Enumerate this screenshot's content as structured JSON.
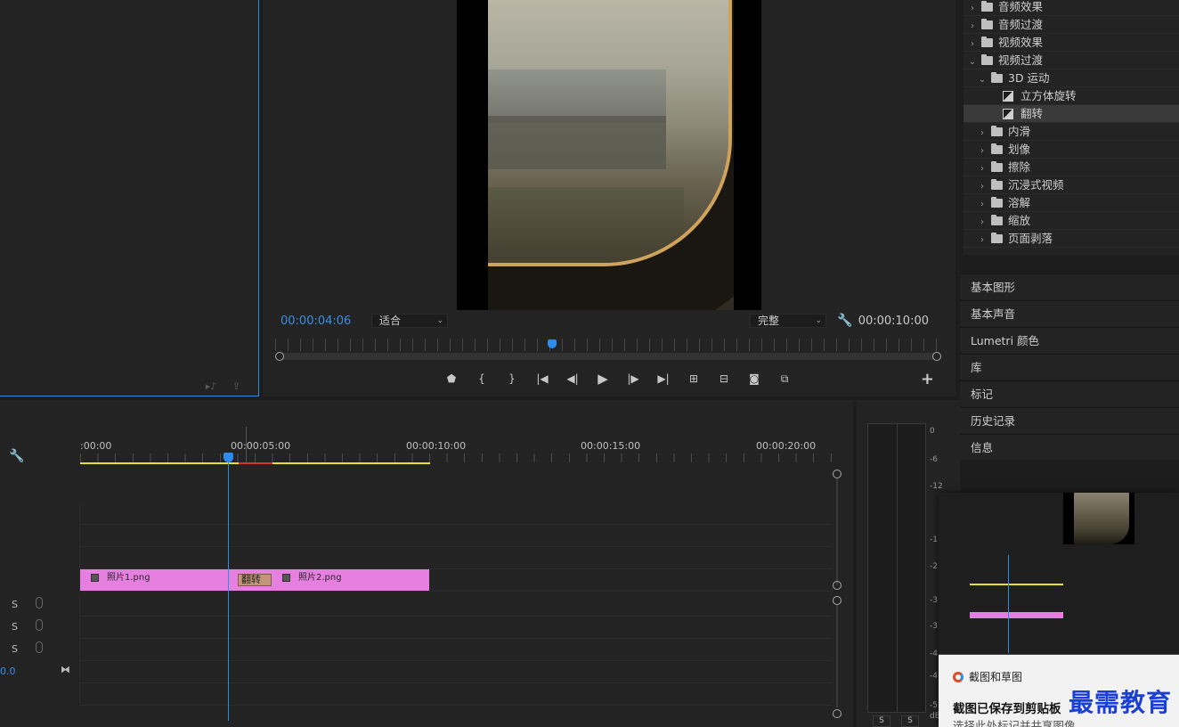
{
  "monitor": {
    "timecode_current": "00:00:04:06",
    "timecode_duration": "00:00:10:00",
    "zoom_select": "适合",
    "quality_select": "完整",
    "playhead_fraction": 0.41
  },
  "effects_tree": [
    {
      "label": "音频效果",
      "depth": 0,
      "kind": "folder",
      "expanded": false
    },
    {
      "label": "音频过渡",
      "depth": 0,
      "kind": "folder",
      "expanded": false
    },
    {
      "label": "视频效果",
      "depth": 0,
      "kind": "folder",
      "expanded": false
    },
    {
      "label": "视频过渡",
      "depth": 0,
      "kind": "folder",
      "expanded": true
    },
    {
      "label": "3D 运动",
      "depth": 1,
      "kind": "folder",
      "expanded": true
    },
    {
      "label": "立方体旋转",
      "depth": 2,
      "kind": "effect"
    },
    {
      "label": "翻转",
      "depth": 2,
      "kind": "effect",
      "selected": true
    },
    {
      "label": "内滑",
      "depth": 1,
      "kind": "folder",
      "expanded": false
    },
    {
      "label": "划像",
      "depth": 1,
      "kind": "folder",
      "expanded": false
    },
    {
      "label": "擦除",
      "depth": 1,
      "kind": "folder",
      "expanded": false
    },
    {
      "label": "沉浸式视频",
      "depth": 1,
      "kind": "folder",
      "expanded": false
    },
    {
      "label": "溶解",
      "depth": 1,
      "kind": "folder",
      "expanded": false
    },
    {
      "label": "缩放",
      "depth": 1,
      "kind": "folder",
      "expanded": false
    },
    {
      "label": "页面剥落",
      "depth": 1,
      "kind": "folder",
      "expanded": false
    }
  ],
  "side_panels": [
    "基本图形",
    "基本声音",
    "Lumetri 颜色",
    "库",
    "标记",
    "历史记录",
    "信息"
  ],
  "timeline": {
    "ruler_times": [
      ":00:00",
      "00:00:05:00",
      "00:00:10:00",
      "00:00:15:00",
      "00:00:20:00"
    ],
    "clips": [
      "照片1.png",
      "照片2.png"
    ],
    "transition": "翻转",
    "audio_track_s": "S",
    "volume_value": "0.0"
  },
  "meters": {
    "db_labels": [
      "0",
      "-6",
      "-12",
      "-1",
      "-2",
      "-3",
      "-3",
      "-4",
      "-4",
      "-5",
      "dB"
    ],
    "solo_labels": [
      "S",
      "S"
    ]
  },
  "toast": {
    "app_name": "截图和草图",
    "title": "截图已保存到剪贴板",
    "subtitle": "选择此处标记并共享图像"
  },
  "watermark": "最需教育",
  "colors": {
    "accent_blue": "#2d8ceb",
    "clip_pink": "#e67fe0",
    "work_area_yellow": "#e8e21f",
    "render_red": "#d8342f"
  }
}
